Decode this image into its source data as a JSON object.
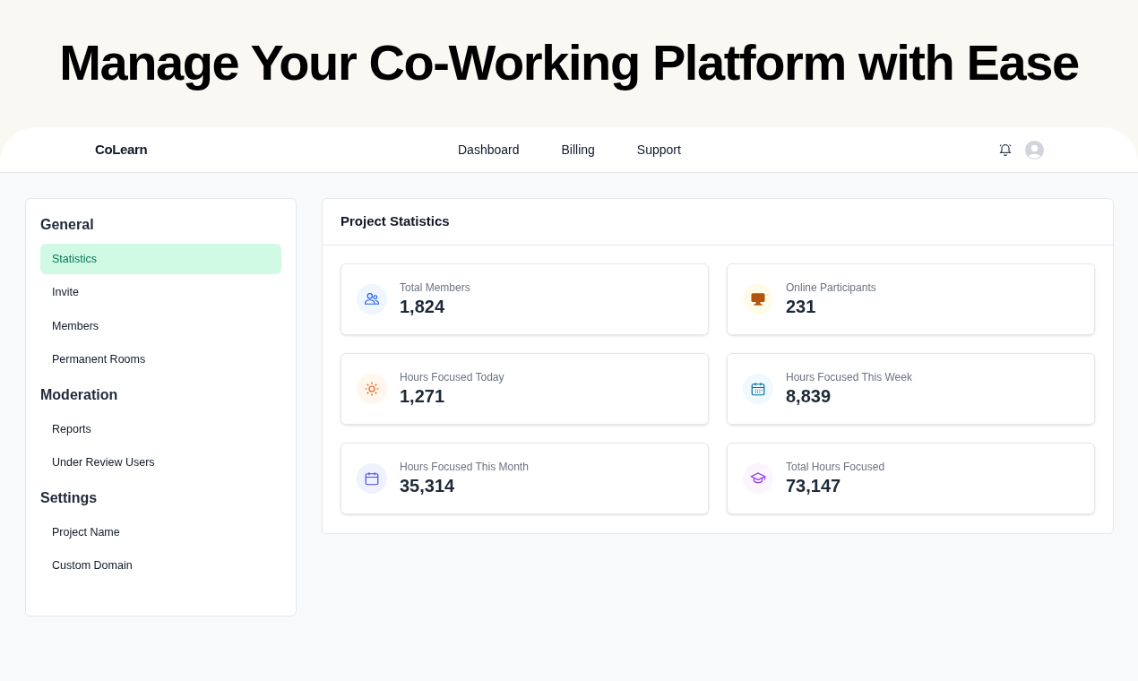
{
  "headline": "Manage Your Co-Working Platform with Ease",
  "header": {
    "logo": "CoLearn",
    "nav": [
      {
        "label": "Dashboard"
      },
      {
        "label": "Billing"
      },
      {
        "label": "Support"
      }
    ]
  },
  "sidebar": {
    "sections": [
      {
        "title": "General",
        "items": [
          {
            "label": "Statistics",
            "selected": true
          },
          {
            "label": "Invite",
            "selected": false
          },
          {
            "label": "Members",
            "selected": false
          },
          {
            "label": "Permanent Rooms",
            "selected": false
          }
        ]
      },
      {
        "title": "Moderation",
        "items": [
          {
            "label": "Reports",
            "selected": false
          },
          {
            "label": "Under Review Users",
            "selected": false
          }
        ]
      },
      {
        "title": "Settings",
        "items": [
          {
            "label": "Project Name",
            "selected": false
          },
          {
            "label": "Custom Domain",
            "selected": false
          }
        ]
      }
    ]
  },
  "panel": {
    "title": "Project Statistics",
    "stats": [
      {
        "kind": "members",
        "label": "Total Members",
        "value": "1,824"
      },
      {
        "kind": "monitor",
        "label": "Online Participants",
        "value": "231"
      },
      {
        "kind": "sun",
        "label": "Hours Focused Today",
        "value": "1,271"
      },
      {
        "kind": "week",
        "label": "Hours Focused This Week",
        "value": "8,839"
      },
      {
        "kind": "month",
        "label": "Hours Focused This Month",
        "value": "35,314"
      },
      {
        "kind": "cap",
        "label": "Total Hours Focused",
        "value": "73,147"
      }
    ]
  }
}
